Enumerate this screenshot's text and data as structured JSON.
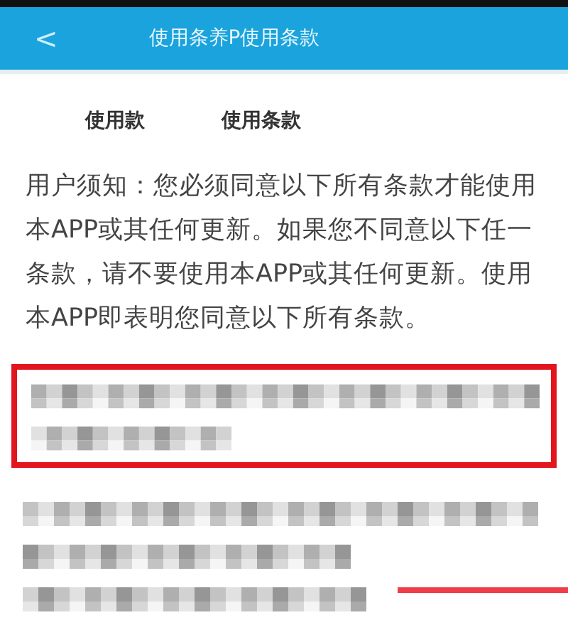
{
  "header": {
    "back": "<",
    "title": "使用条养P使用条款"
  },
  "tabs": [
    {
      "label": "使用款"
    },
    {
      "label": "使用条款"
    }
  ],
  "notice": "用户须知：您必须同意以下所有条款才能使用本APP或其任何更新。如果您不同意以下任一条款，请不要使用本APP或其任何更新。使用本APP即表明您同意以下所有条款。"
}
